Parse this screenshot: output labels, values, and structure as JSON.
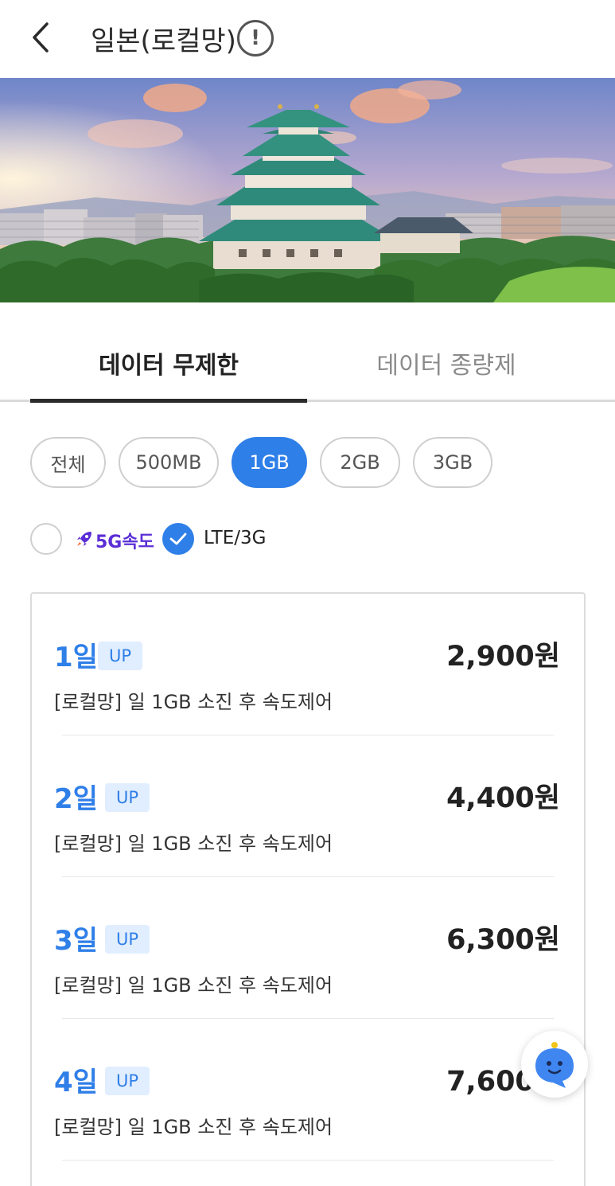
{
  "header": {
    "title": "일본(로컬망)",
    "info_icon_symbol": "!"
  },
  "hero": {
    "image": "Japanese castle with green roofs surrounded by trees and city skyline at sunset"
  },
  "tabs": [
    {
      "label": "데이터 무제한",
      "active": true
    },
    {
      "label": "데이터 종량제",
      "active": false
    }
  ],
  "chips": [
    {
      "label": "전체",
      "active": false
    },
    {
      "label": "500MB",
      "active": false
    },
    {
      "label": "1GB",
      "active": true
    },
    {
      "label": "2GB",
      "active": false
    },
    {
      "label": "3GB",
      "active": false
    }
  ],
  "filters": {
    "five_g_label": "5G속도",
    "five_g_checked": false,
    "lte_label": "LTE/3G",
    "lte_checked": true
  },
  "plans": [
    {
      "days": "1일",
      "badge": "UP",
      "price": "2,900원",
      "desc": "[로컬망] 일 1GB 소진 후 속도제어"
    },
    {
      "days": "2일",
      "badge": "UP",
      "price": "4,400원",
      "desc": "[로컬망] 일 1GB 소진 후 속도제어"
    },
    {
      "days": "3일",
      "badge": "UP",
      "price": "6,300원",
      "desc": "[로컬망] 일 1GB 소진 후 속도제어"
    },
    {
      "days": "4일",
      "badge": "UP",
      "price": "7,600원",
      "desc": "[로컬망] 일 1GB 소진 후 속도제어"
    }
  ],
  "colors": {
    "accent": "#2f7fe8",
    "badge_bg": "#e1eeff",
    "five_g_purple": "#5b2ed6"
  },
  "icons": {
    "back": "chevron-left-icon",
    "info": "info-circle-icon",
    "rocket": "rocket-icon",
    "check": "check-icon",
    "chatbot": "chatbot-icon"
  }
}
